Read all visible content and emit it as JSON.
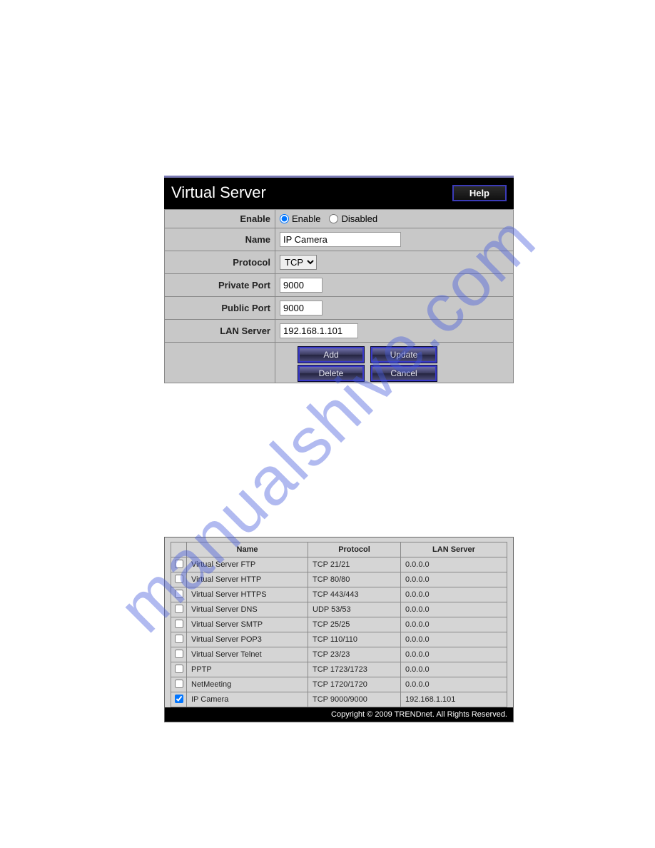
{
  "watermark": "manualshive.com",
  "panel1": {
    "title": "Virtual Server",
    "help_label": "Help",
    "rows": {
      "enable_label": "Enable",
      "enable_opt": "Enable",
      "disabled_opt": "Disabled",
      "name_label": "Name",
      "name_value": "IP Camera",
      "protocol_label": "Protocol",
      "protocol_value": "TCP",
      "private_port_label": "Private Port",
      "private_port_value": "9000",
      "public_port_label": "Public Port",
      "public_port_value": "9000",
      "lan_server_label": "LAN Server",
      "lan_server_value": "192.168.1.101"
    },
    "buttons": {
      "add": "Add",
      "update": "Update",
      "delete": "Delete",
      "cancel": "Cancel"
    }
  },
  "panel2": {
    "headers": {
      "name": "Name",
      "protocol": "Protocol",
      "lan": "LAN Server"
    },
    "rows": [
      {
        "checked": false,
        "name": "Virtual Server FTP",
        "protocol": "TCP 21/21",
        "lan": "0.0.0.0"
      },
      {
        "checked": false,
        "name": "Virtual Server HTTP",
        "protocol": "TCP 80/80",
        "lan": "0.0.0.0"
      },
      {
        "checked": false,
        "name": "Virtual Server HTTPS",
        "protocol": "TCP 443/443",
        "lan": "0.0.0.0"
      },
      {
        "checked": false,
        "name": "Virtual Server DNS",
        "protocol": "UDP 53/53",
        "lan": "0.0.0.0"
      },
      {
        "checked": false,
        "name": "Virtual Server SMTP",
        "protocol": "TCP 25/25",
        "lan": "0.0.0.0"
      },
      {
        "checked": false,
        "name": "Virtual Server POP3",
        "protocol": "TCP 110/110",
        "lan": "0.0.0.0"
      },
      {
        "checked": false,
        "name": "Virtual Server Telnet",
        "protocol": "TCP 23/23",
        "lan": "0.0.0.0"
      },
      {
        "checked": false,
        "name": "PPTP",
        "protocol": "TCP 1723/1723",
        "lan": "0.0.0.0"
      },
      {
        "checked": false,
        "name": "NetMeeting",
        "protocol": "TCP 1720/1720",
        "lan": "0.0.0.0"
      },
      {
        "checked": true,
        "name": "IP Camera",
        "protocol": "TCP 9000/9000",
        "lan": "192.168.1.101"
      }
    ],
    "footer": "Copyright © 2009 TRENDnet. All Rights Reserved."
  }
}
